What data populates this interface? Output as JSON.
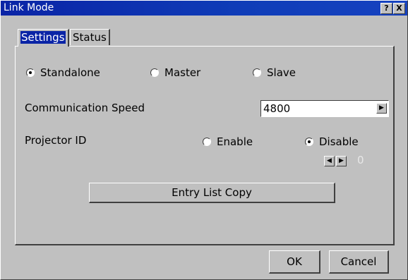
{
  "window": {
    "title": "Link Mode",
    "help_label": "?",
    "close_label": "X"
  },
  "tabs": [
    {
      "label": "Settings",
      "active": true
    },
    {
      "label": "Status",
      "active": false
    }
  ],
  "link_mode": {
    "options": [
      "Standalone",
      "Master",
      "Slave"
    ],
    "selected": "Standalone"
  },
  "communication_speed": {
    "label": "Communication Speed",
    "value": "4800",
    "arrow": "▶"
  },
  "projector_id": {
    "label": "Projector ID",
    "enable_label": "Enable",
    "disable_label": "Disable",
    "selected": "Disable",
    "stepper_value": "0",
    "dec_arrow": "◀",
    "inc_arrow": "▶"
  },
  "entry_list_copy_label": "Entry List Copy",
  "footer": {
    "ok_label": "OK",
    "cancel_label": "Cancel"
  }
}
